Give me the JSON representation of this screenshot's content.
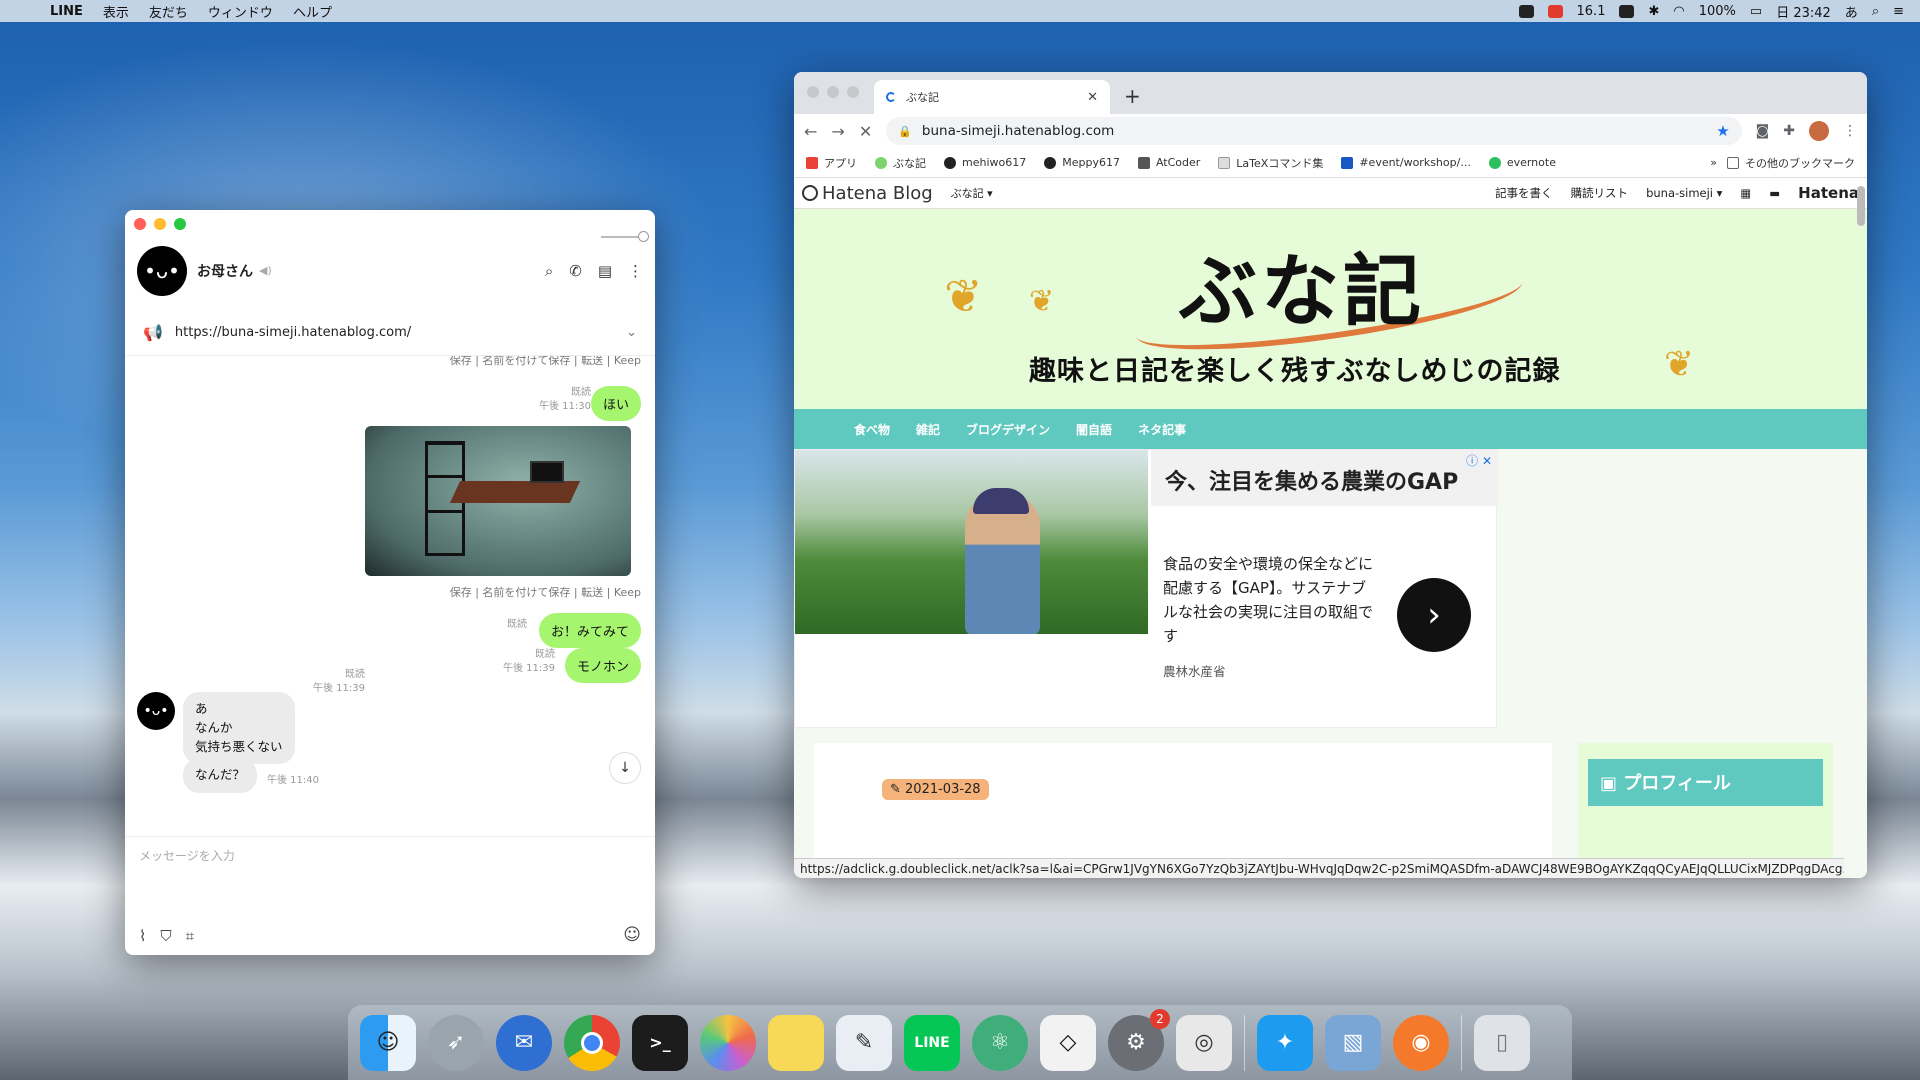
{
  "menubar": {
    "app": "LINE",
    "items": [
      "表示",
      "友だち",
      "ウィンドウ",
      "ヘルプ"
    ],
    "status_temp": "16.1",
    "battery": "100%",
    "clock": "日 23:42",
    "input_method": "あ"
  },
  "line": {
    "contact_name": "お母さん",
    "avatar_glyph": "•ᴗ•",
    "announcement_url": "https://buna-simeji.hatenablog.com/",
    "actions_label": "保存 | 名前を付けて保存 | 転送 | Keep",
    "msg_hoi": "ほい",
    "msg_hoi_meta_read": "既読",
    "msg_hoi_meta_time": "午後 11:30",
    "photo_meta_read": "既読",
    "photo_meta_time": "午後 11:39",
    "msg_mitemite": "お！みてみて",
    "msg_mitemite_read": "既読",
    "msg_monohon": "モノホン",
    "msg_monohon_read": "既読",
    "msg_monohon_time": "午後 11:39",
    "other_msg_1_line1": "あ",
    "other_msg_1_line2": "なんか",
    "other_msg_1_line3": "気持ち悪くない",
    "other_msg_2": "なんだ？",
    "other_msg_time": "午後 11:40",
    "input_placeholder": "メッセージを入力"
  },
  "chrome": {
    "tab_title": "ぶな記",
    "url": "buna-simeji.hatenablog.com",
    "bookmarks": [
      "アプリ",
      "ぶな記",
      "mehiwo617",
      "Meppy617",
      "AtCoder",
      "LaTeXコマンド集",
      "#event/workshop/...",
      "evernote"
    ],
    "bookmarks_more": "その他のブックマーク",
    "status_url": "https://adclick.g.doubleclick.net/aclk?sa=l&ai=CPGrw1JVgYN6XGo7YzQb3jZAYtJbu-WHvqJqDqw2C-p2SmiMQASDfm-aDAWCJ48WE9BOgAYKZqqQCyAEJqQLLUCixMJZDPqgDAcg..."
  },
  "blog": {
    "hatena_logo": "Hatena Blog",
    "blog_menu": "ぶな記 ▾",
    "write": "記事を書く",
    "reading_list": "購読リスト",
    "user": "buna-simeji ▾",
    "hatena": "Hatena",
    "hero_title": "ぶな記",
    "hero_sub": "趣味と日記を楽しく残すぶなしめじの記録",
    "nav": [
      "食べ物",
      "雑記",
      "ブログデザイン",
      "闇自語",
      "ネタ記事"
    ],
    "ad_heading": "今、注目を集める農業のGAP",
    "ad_body": "食品の安全や環境の保全などに配慮する【GAP】。サステナブルな社会の実現に注目の取組です",
    "ad_source": "農林水産省",
    "date": "2021-03-28",
    "profile": "プロフィール"
  },
  "dock": {
    "items": [
      "finder",
      "launchpad",
      "airmail",
      "chrome",
      "terminal",
      "photos",
      "notes",
      "textedit",
      "line",
      "atom",
      "unity",
      "system-preferences",
      "screenshot",
      "twitter",
      "preview",
      "blender",
      "trash"
    ],
    "sys_pref_badge": "2"
  }
}
